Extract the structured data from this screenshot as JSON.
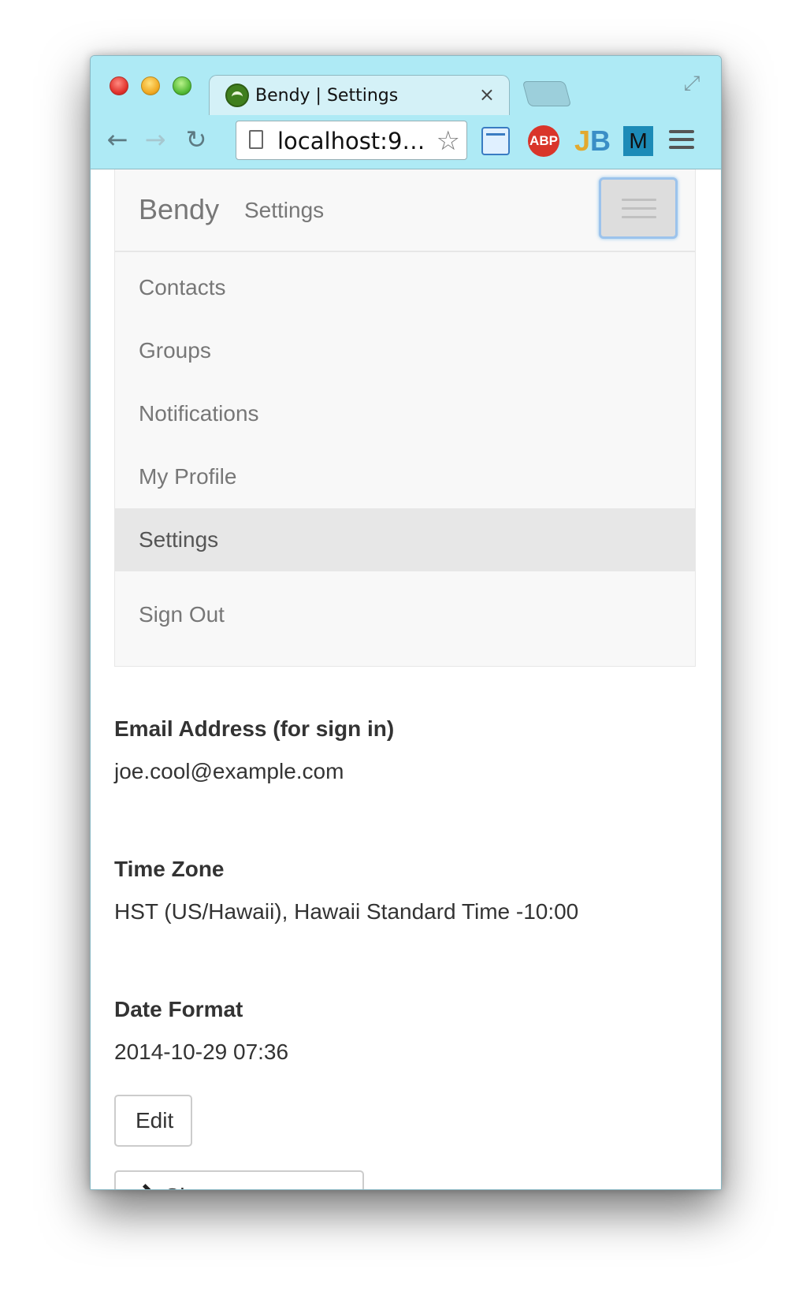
{
  "browser": {
    "tab_title": "Bendy | Settings",
    "tab_close": "×",
    "url": "localhost:9…",
    "extensions": {
      "abp": "ABP",
      "jb_j": "J",
      "jb_b": "B",
      "m": "M"
    }
  },
  "navbar": {
    "brand": "Bendy",
    "section": "Settings",
    "items": [
      {
        "label": "Contacts",
        "active": false
      },
      {
        "label": "Groups",
        "active": false
      },
      {
        "label": "Notifications",
        "active": false
      },
      {
        "label": "My Profile",
        "active": false
      },
      {
        "label": "Settings",
        "active": true
      },
      {
        "label": "Sign Out",
        "active": false
      }
    ]
  },
  "settings": {
    "email_label": "Email Address (for sign in)",
    "email_value": "joe.cool@example.com",
    "timezone_label": "Time Zone",
    "timezone_value": "HST (US/Hawaii), Hawaii Standard Time -10:00",
    "date_format_label": "Date Format",
    "date_format_value": "2014-10-29 07:36",
    "edit_button": "Edit",
    "change_password_button": "Change Password"
  },
  "colors": {
    "chrome": "#aeeaf5",
    "navbar_bg": "#f8f8f8",
    "active_item_bg": "#e7e7e7",
    "muted_text": "#777777"
  }
}
